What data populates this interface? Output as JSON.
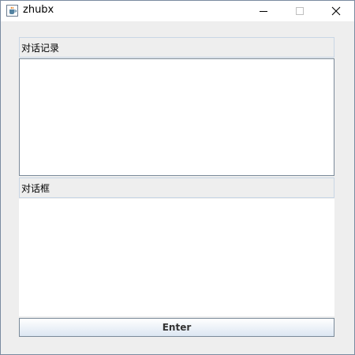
{
  "window": {
    "title": "zhubx"
  },
  "icons": {
    "app": "java-coffee-icon",
    "minimize": "minimize-icon",
    "maximize": "maximize-icon",
    "close": "close-icon"
  },
  "main": {
    "record_label": "对话记录",
    "record_text": "",
    "input_label": "对话框",
    "input_text": "",
    "enter_label": "Enter"
  }
}
